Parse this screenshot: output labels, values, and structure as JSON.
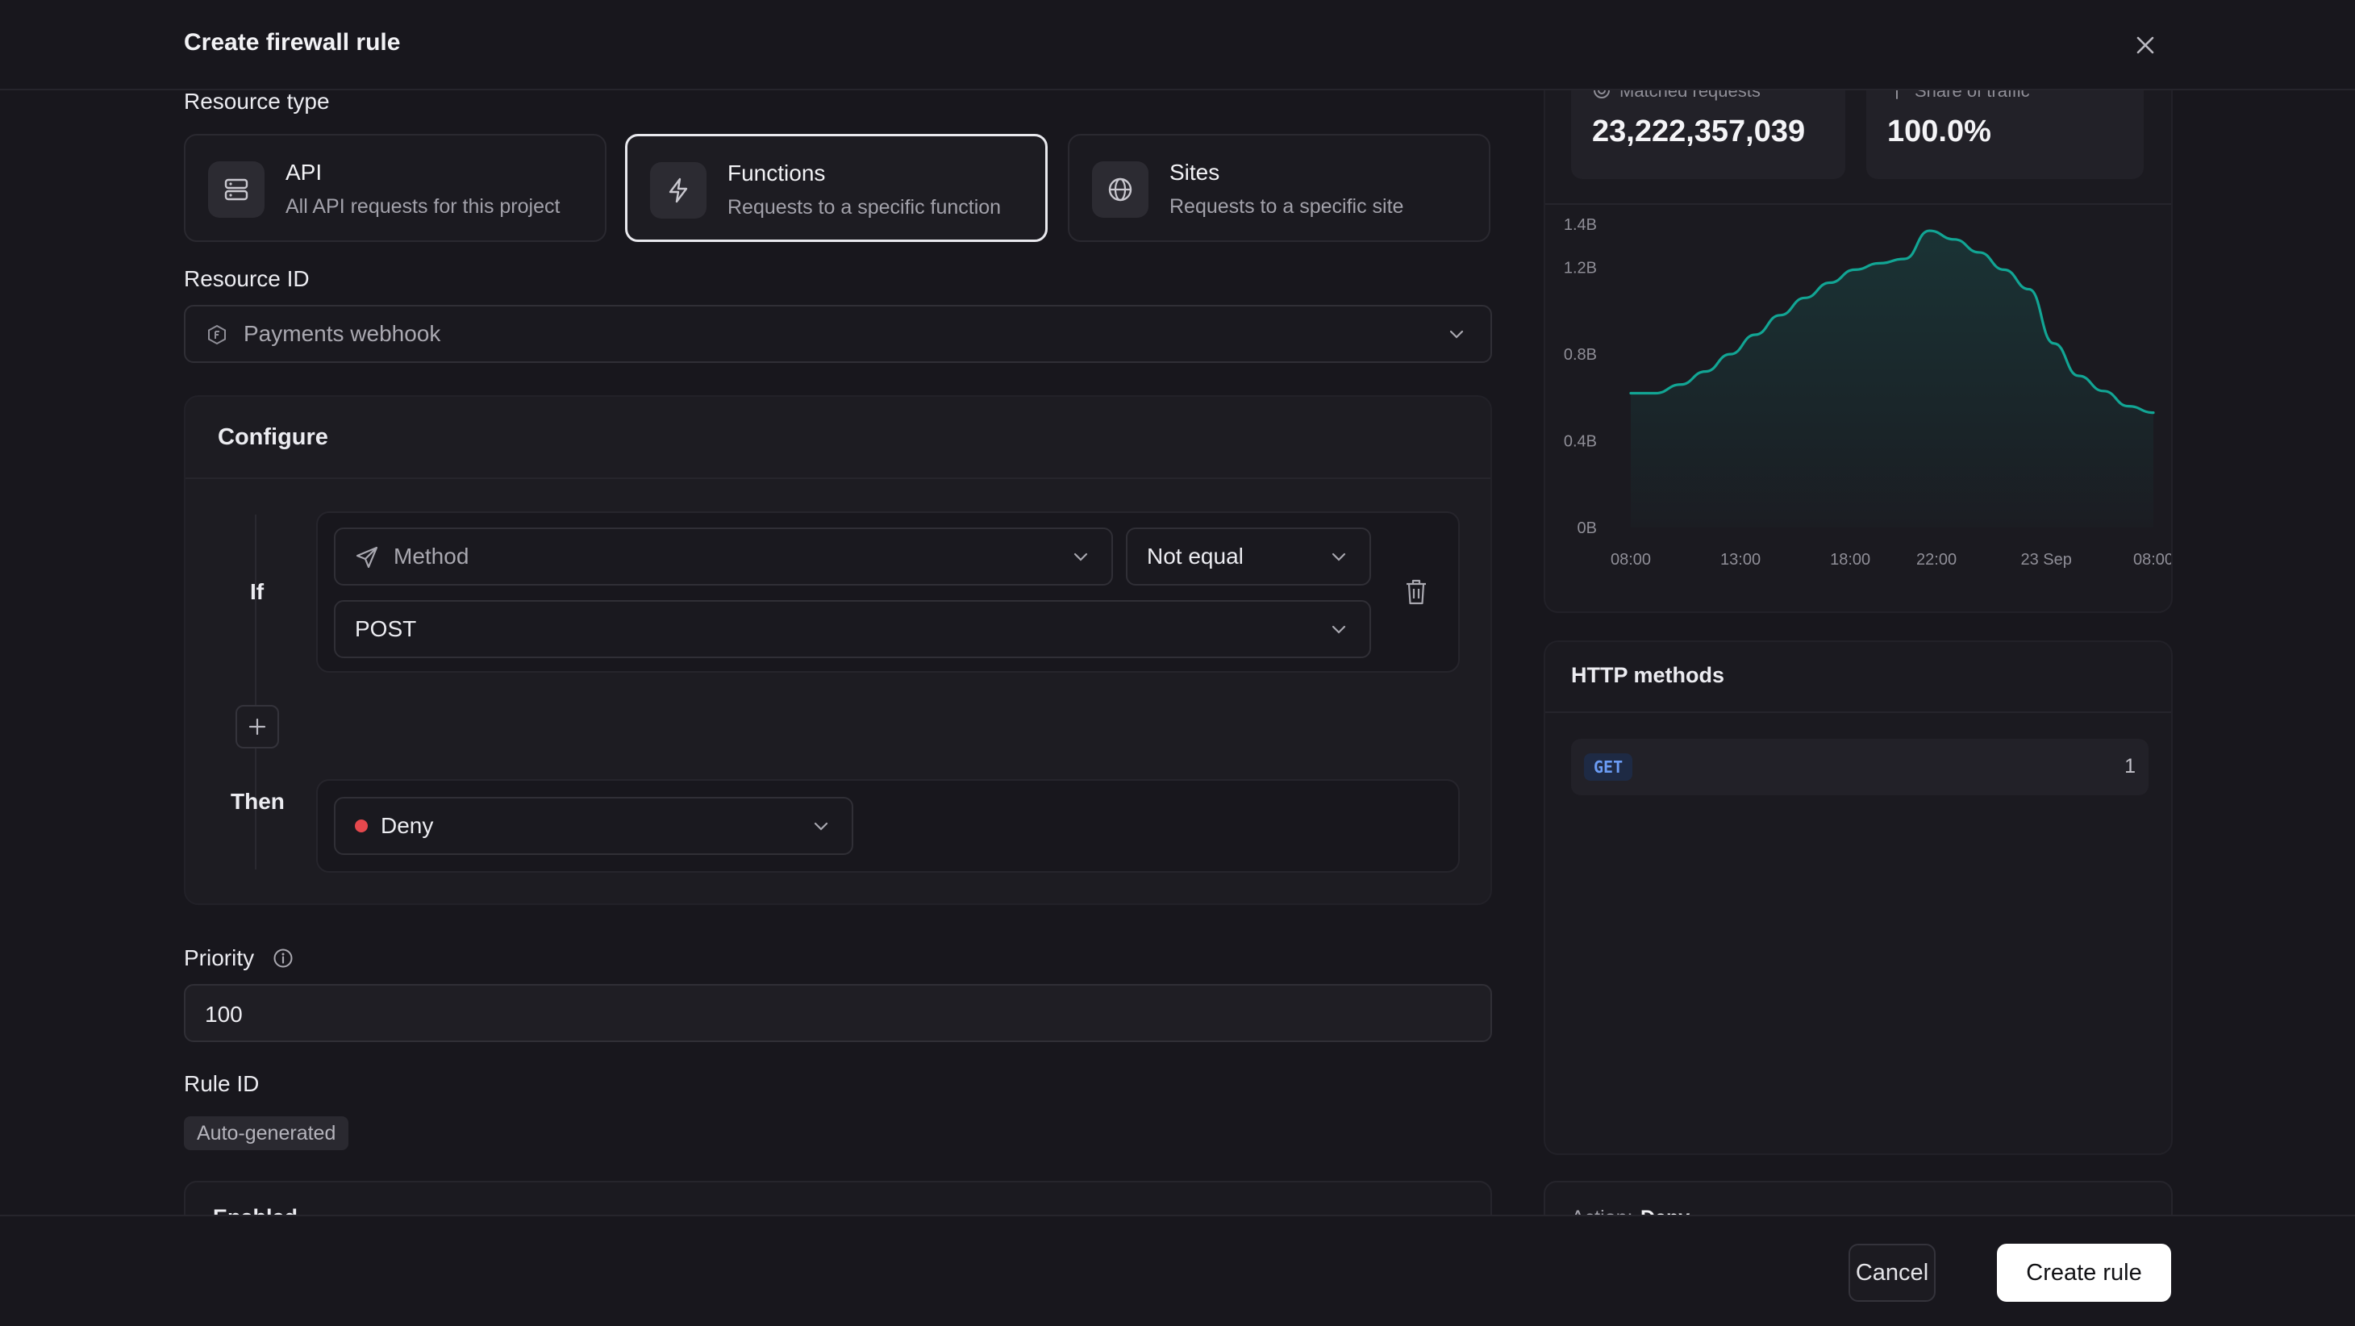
{
  "header": {
    "title": "Create firewall rule"
  },
  "resource_type": {
    "label": "Resource type",
    "options": [
      {
        "title": "API",
        "description": "All API requests for this project",
        "icon": "server-icon",
        "selected": false
      },
      {
        "title": "Functions",
        "description": "Requests to a specific function",
        "icon": "lightning-icon",
        "selected": true
      },
      {
        "title": "Sites",
        "description": "Requests to a specific site",
        "icon": "globe-icon",
        "selected": false
      }
    ]
  },
  "resource_id": {
    "label": "Resource ID",
    "value": "Payments webhook"
  },
  "configure": {
    "title": "Configure",
    "if_label": "If",
    "then_label": "Then",
    "condition": {
      "field": "Method",
      "operator": "Not equal",
      "value": "POST"
    },
    "action": {
      "value": "Deny",
      "color": "#e5484d"
    }
  },
  "priority": {
    "label": "Priority",
    "value": "100"
  },
  "rule_id": {
    "label": "Rule ID",
    "value": "Auto-generated"
  },
  "enabled": {
    "label": "Enabled"
  },
  "stats": {
    "matched_label": "Matched requests",
    "matched_value": "23,222,357,039",
    "share_label": "Share of traffic",
    "share_value": "100.0%"
  },
  "chart_data": {
    "type": "area",
    "y_ticks": [
      "1.4B",
      "1.2B",
      "0.8B",
      "0.4B",
      "0B"
    ],
    "x_ticks": [
      "08:00",
      "13:00",
      "18:00",
      "22:00",
      "23 Sep",
      "08:00"
    ],
    "ylim": [
      0,
      1.4
    ],
    "unit": "B",
    "x": [
      0,
      1,
      2,
      3,
      4,
      5,
      6,
      7,
      8,
      9,
      10,
      11,
      12,
      13,
      14,
      15,
      16,
      17,
      18,
      19,
      20,
      21,
      22,
      23,
      24
    ],
    "values": [
      0.62,
      0.62,
      0.66,
      0.72,
      0.8,
      0.89,
      0.98,
      1.06,
      1.13,
      1.19,
      1.22,
      1.24,
      1.37,
      1.33,
      1.27,
      1.19,
      1.1,
      0.85,
      0.7,
      0.63,
      0.56,
      0.53
    ],
    "color": "#12a594"
  },
  "http_methods": {
    "title": "HTTP methods",
    "rows": [
      {
        "method": "GET",
        "count": "1"
      }
    ]
  },
  "summary": {
    "action_label": "Action:",
    "action_value": "Deny"
  },
  "footer": {
    "cancel_label": "Cancel",
    "create_label": "Create rule"
  }
}
